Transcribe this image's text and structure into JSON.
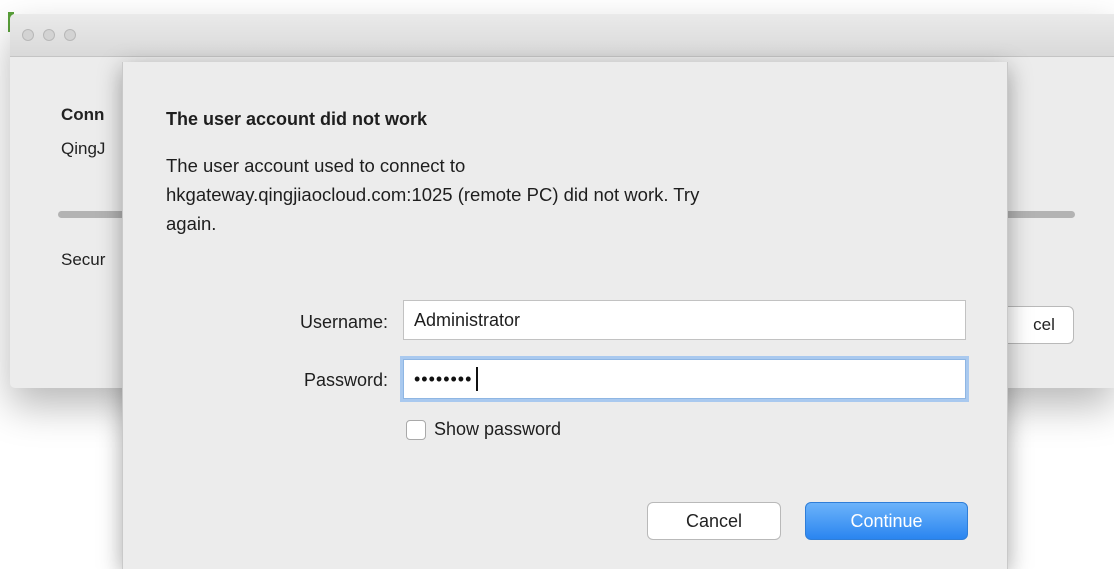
{
  "background_window": {
    "heading_fragment": "Conn",
    "app_fragment": "QingJ",
    "status_fragment": "Secur",
    "cancel_label_fragment": "cel"
  },
  "dialog": {
    "title": "The user account did not work",
    "message_lines": [
      "The user account used to connect to",
      "hkgateway.qingjiaocloud.com:1025 (remote PC) did not work. Try",
      "again."
    ],
    "username_label": "Username:",
    "username_value": "Administrator",
    "password_label": "Password:",
    "password_masked": "••••••••",
    "show_password_label": "Show password",
    "show_password_checked": false,
    "cancel_label": "Cancel",
    "continue_label": "Continue"
  },
  "colors": {
    "accent": "#2a85f0",
    "focus_ring": "#a9c9ef",
    "window_bg": "#ececec"
  }
}
